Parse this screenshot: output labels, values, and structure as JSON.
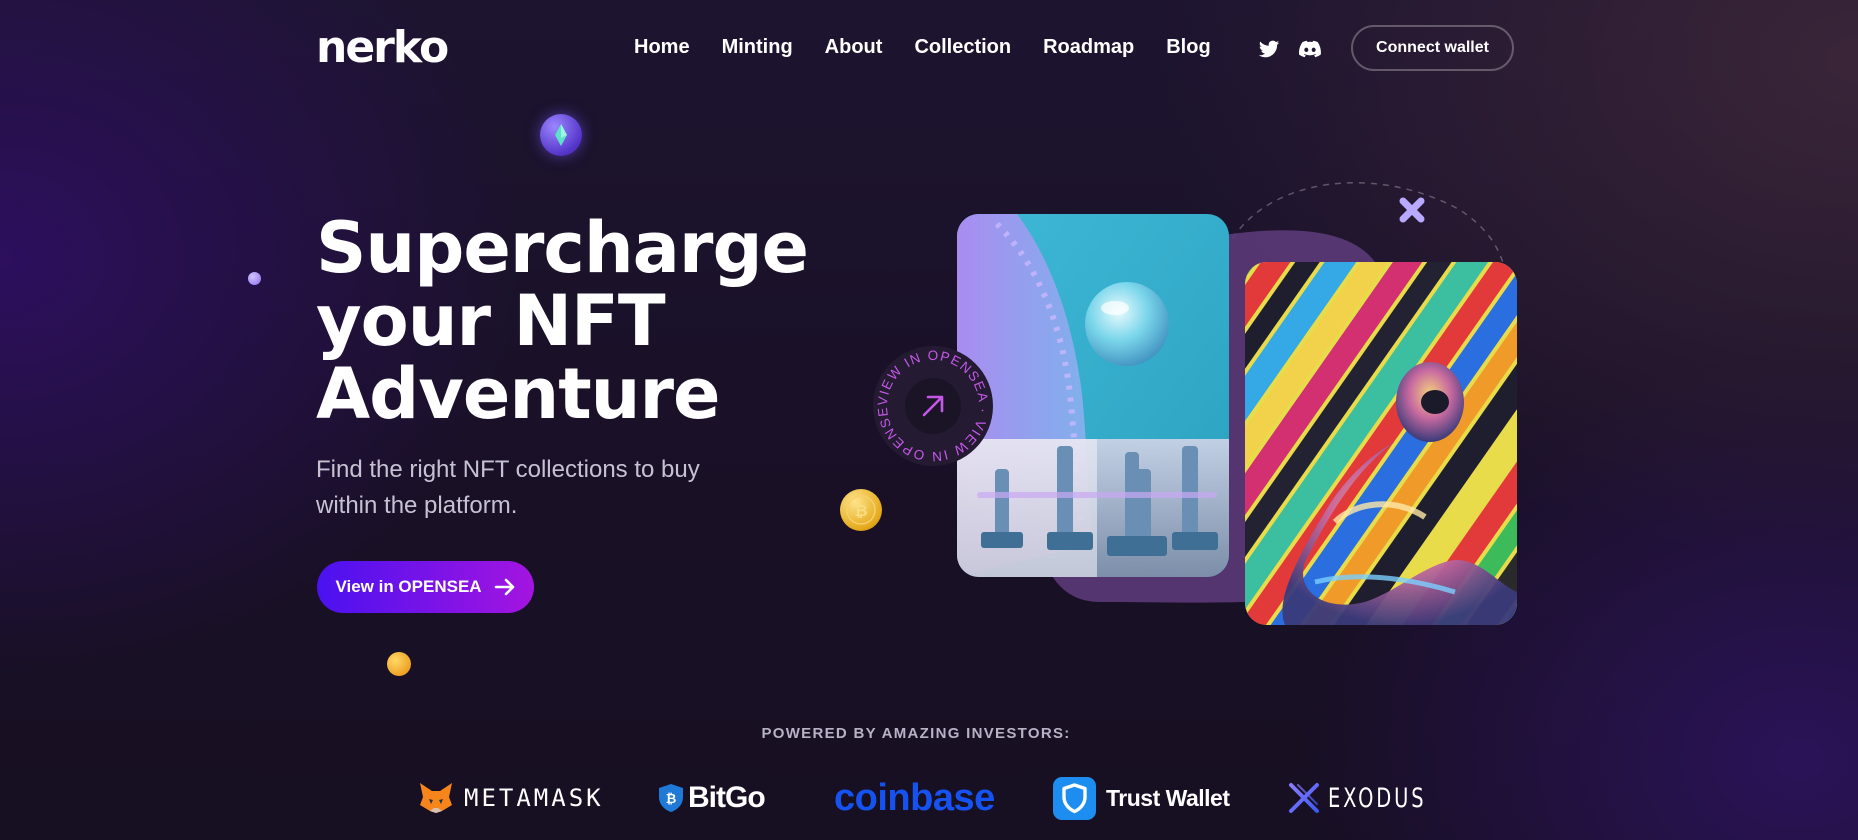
{
  "brand": {
    "logo_text": "nerko"
  },
  "nav": {
    "items": [
      {
        "label": "Home"
      },
      {
        "label": "Minting"
      },
      {
        "label": "About"
      },
      {
        "label": "Collection"
      },
      {
        "label": "Roadmap"
      },
      {
        "label": "Blog"
      }
    ],
    "social_icons": [
      "twitter-icon",
      "discord-icon"
    ],
    "connect_label": "Connect wallet"
  },
  "hero": {
    "title_lines": [
      "Supercharge",
      "your NFT",
      "Adventure"
    ],
    "subtitle_lines": [
      "Find the right NFT collections to buy",
      "within the platform."
    ],
    "cta_label": "View in OPENSEA",
    "cta_icon": "arrow-right-icon",
    "badge_text": "VIEW IN OPENSEA · VIEW IN OPENSEA ·",
    "badge_icon": "arrow-up-right-icon"
  },
  "investors": {
    "title": "POWERED BY AMAZING INVESTORS:",
    "logos": [
      {
        "name": "METAMASK",
        "icon": "fox-icon"
      },
      {
        "name": "BitGo",
        "icon": "bitgo-shield-icon"
      },
      {
        "name": "coinbase",
        "icon": ""
      },
      {
        "name": "Trust Wallet",
        "icon": "trust-shield-icon"
      },
      {
        "name": "EXODUS",
        "icon": "exodus-x-icon"
      }
    ]
  },
  "colors": {
    "background": "#1b1229",
    "cta_gradient_start": "#4a12f0",
    "cta_gradient_end": "#a414e0",
    "coinbase_blue": "#1652f0",
    "accent_purple": "#7d55f0",
    "badge_text": "#c558e8"
  }
}
